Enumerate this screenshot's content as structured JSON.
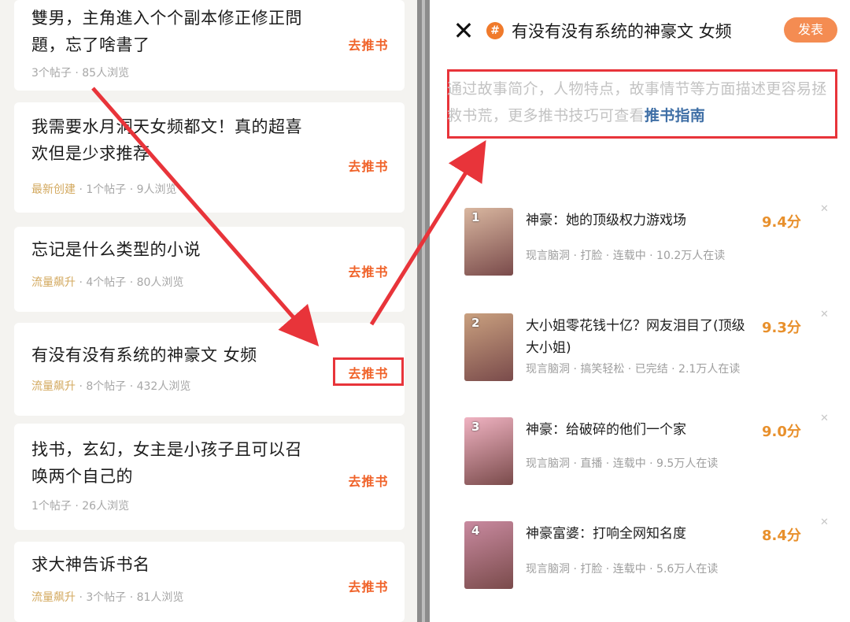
{
  "left_list": {
    "action_label": "去推书",
    "items": [
      {
        "title": "雙男，主角進入个个副本修正修正問題，忘了啥書了",
        "tag": "",
        "meta": "3个帖子 · 85人浏览"
      },
      {
        "title": "我需要水月洞天女频都文！真的超喜欢但是少求推荐",
        "tag": "最新创建",
        "meta": " · 1个帖子 · 9人浏览"
      },
      {
        "title": "忘记是什么类型的小说",
        "tag": "流量飙升",
        "meta": " · 4个帖子 · 80人浏览"
      },
      {
        "title": "有没有没有系统的神豪文 女频",
        "tag": "流量飙升",
        "meta": " · 8个帖子 · 432人浏览"
      },
      {
        "title": "找书，玄幻，女主是小孩子且可以召唤两个自己的",
        "tag": "",
        "meta": "1个帖子 · 26人浏览"
      },
      {
        "title": "求大神告诉书名",
        "tag": "流量飙升",
        "meta": " · 3个帖子 · 81人浏览"
      }
    ]
  },
  "right_panel": {
    "close_icon": "close-icon",
    "hash_glyph": "#",
    "title": "有没有没有系统的神豪文 女频",
    "publish_label": "发表",
    "hint_text": "通过故事简介，人物特点，故事情节等方面描述更容易拯救书荒，更多推书技巧可查看",
    "hint_link": "推书指南",
    "books": [
      {
        "rank": "1",
        "title": "神豪：她的顶级权力游戏场",
        "score": "9.4分",
        "meta": "现言脑洞 · 打脸 · 连载中 · 10.2万人在读",
        "cover": "#d9b7a0"
      },
      {
        "rank": "2",
        "title": "大小姐零花钱十亿？网友泪目了(顶级大小姐)",
        "score": "9.3分",
        "meta": "现言脑洞 · 搞笑轻松 · 已完结 · 2.1万人在读",
        "cover": "#c9a07f"
      },
      {
        "rank": "3",
        "title": "神豪：给破碎的他们一个家",
        "score": "9.0分",
        "meta": "现言脑洞 · 直播 · 连载中 · 9.5万人在读",
        "cover": "#f0b3c2"
      },
      {
        "rank": "4",
        "title": "神豪富婆：打响全网知名度",
        "score": "8.4分",
        "meta": "现言脑洞 · 打脸 · 连载中 · 5.6万人在读",
        "cover": "#c98aa0"
      }
    ]
  },
  "colors": {
    "accent_orange": "#f0632a",
    "highlight_red": "#e8343a",
    "score_orange": "#e8902c",
    "tag_gold": "#d3a95f",
    "link_blue": "#3f6fa6"
  }
}
